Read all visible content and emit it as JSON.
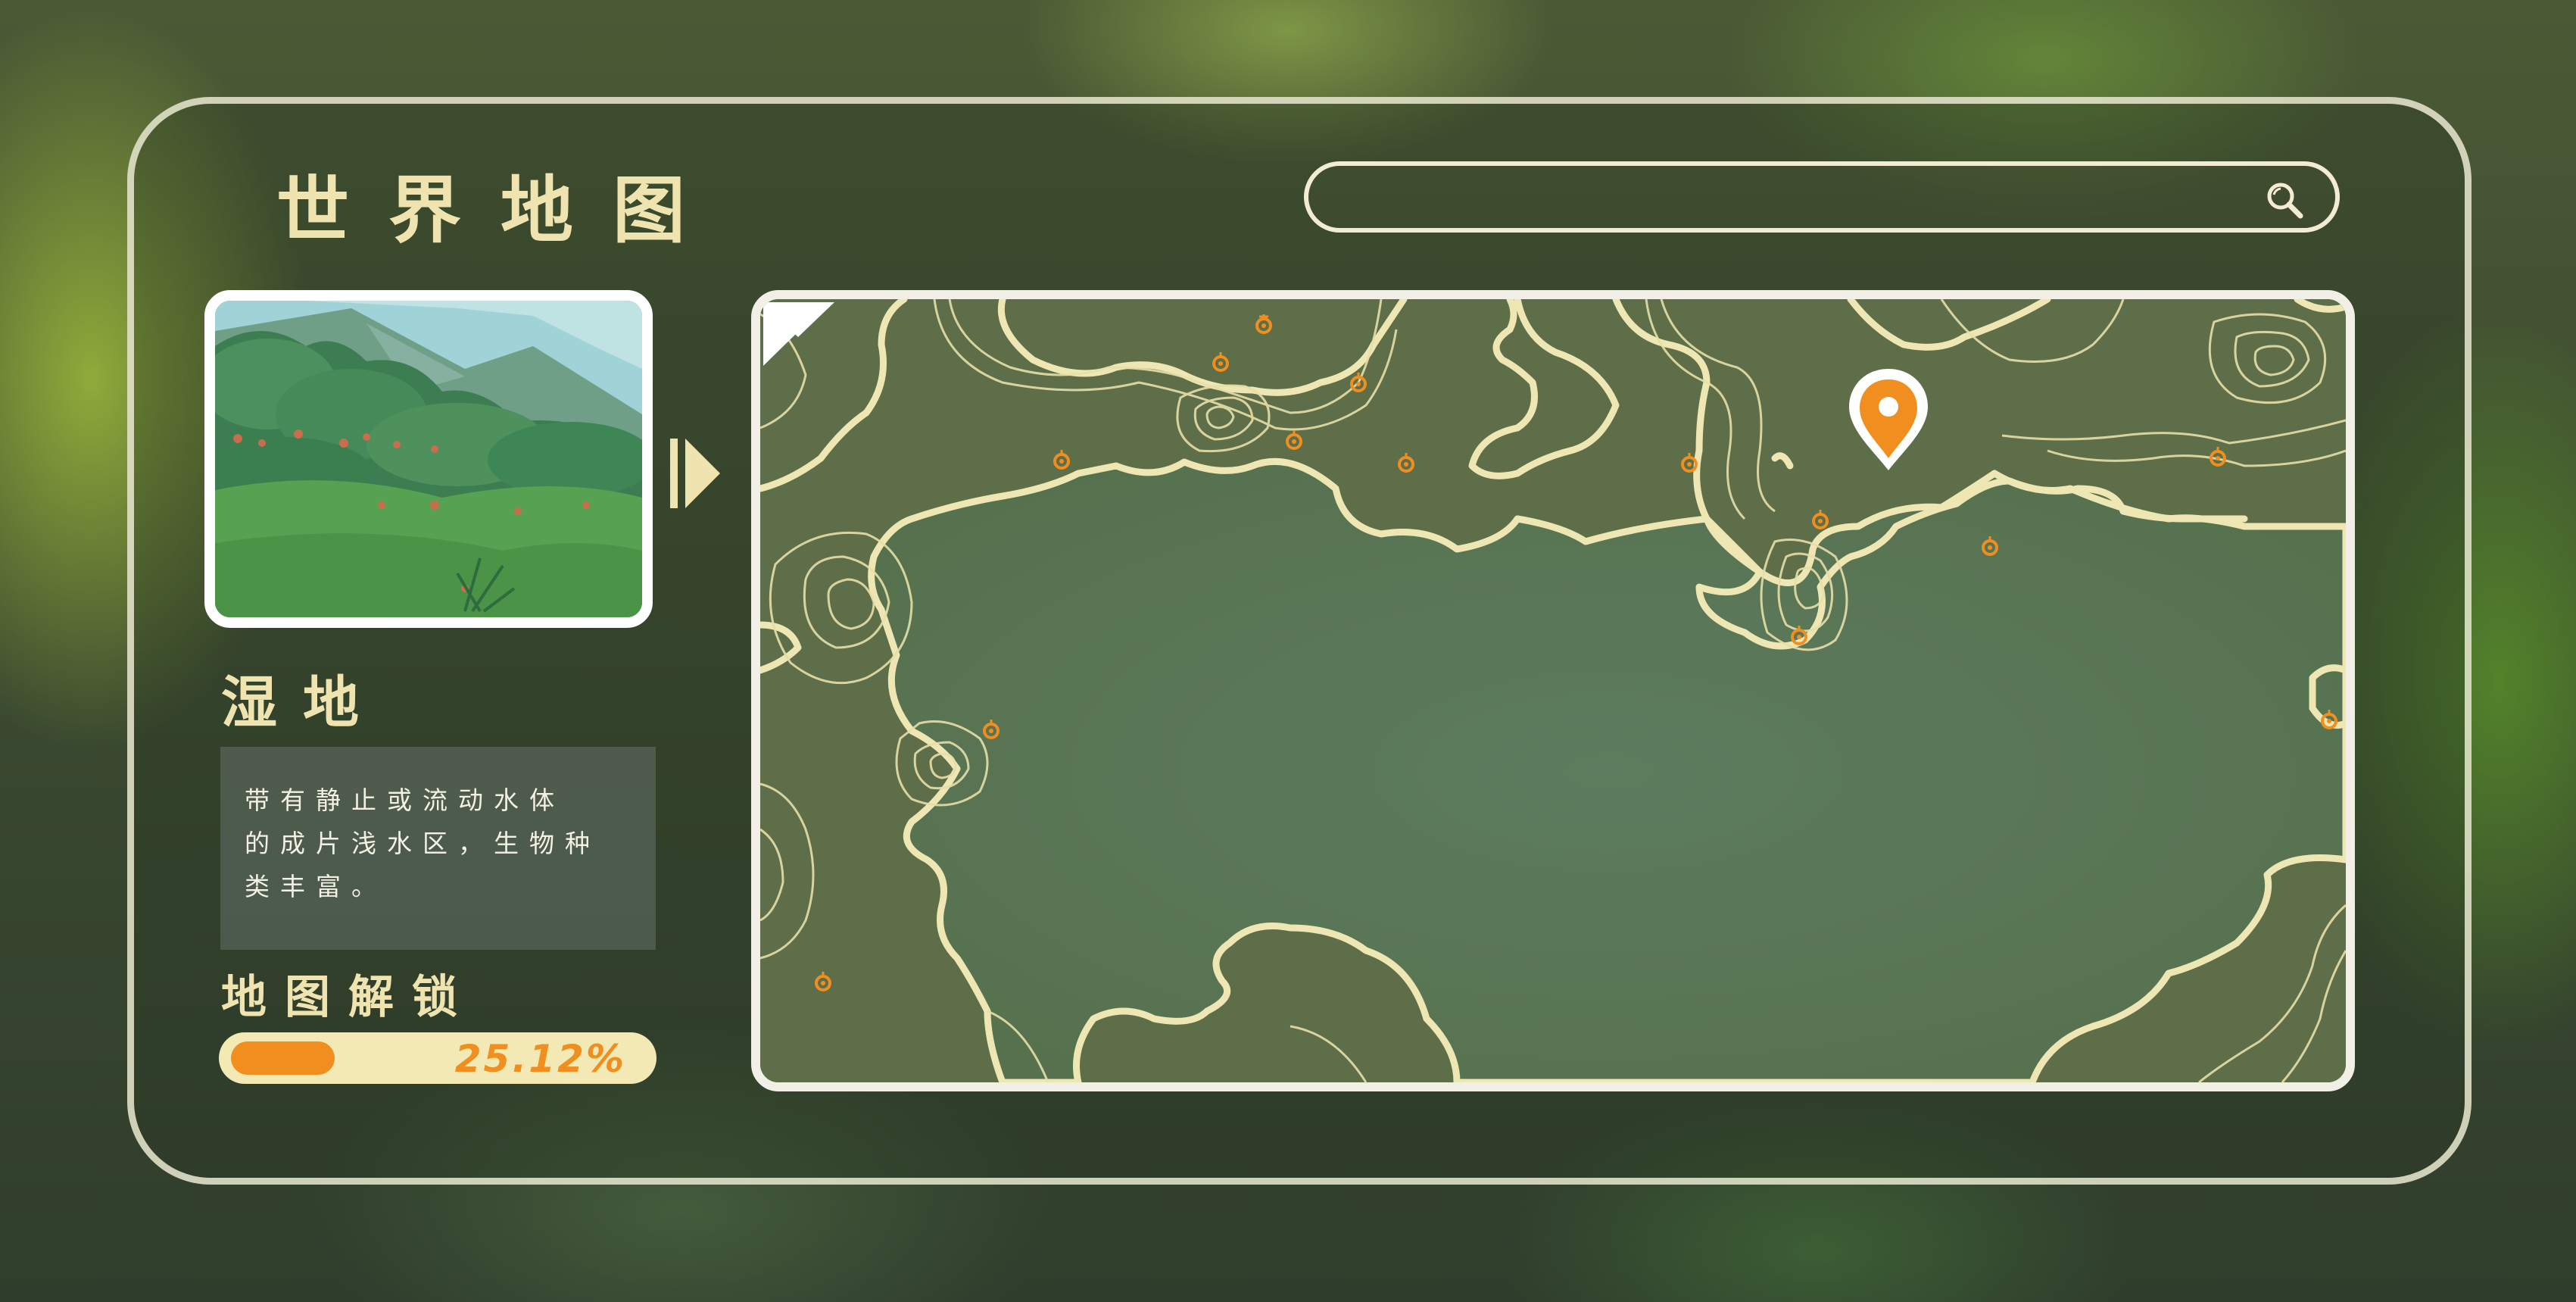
{
  "title": "世界地图",
  "search": {
    "placeholder": "",
    "icon": "search-icon"
  },
  "region": {
    "name": "湿地",
    "description_lines": [
      "带有静止或流动水体",
      "的成片浅水区，生物种",
      "类丰富。"
    ]
  },
  "unlock": {
    "label": "地图解锁",
    "percent_text": "25.12%",
    "progress": 0.2512
  },
  "colors": {
    "accent": "#f08f1f",
    "title_text": "#efe4b0",
    "map_bg": "#5e6f4a",
    "contour": "#efe7b3",
    "panel_border": "#ebebd2"
  },
  "map": {
    "pin_icon": "location-pin-icon",
    "marker_icon": "flower-marker-icon",
    "nav_right_icon": "chevron-right-icon",
    "nav_down_icon": "chevron-down-icon"
  }
}
